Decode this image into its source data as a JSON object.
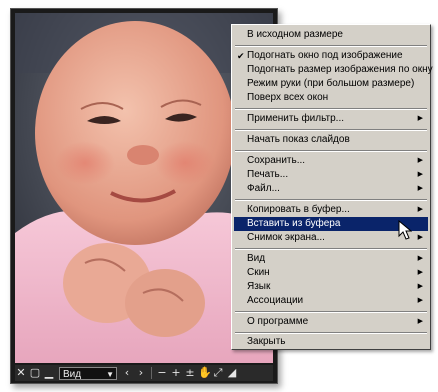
{
  "toolbar": {
    "close_icon": "close-icon",
    "restore_icon": "window-icon",
    "minimize_icon": "minimize-icon",
    "view_select_value": "Вид",
    "prev_icon": "chevron-left-icon",
    "next_icon": "chevron-right-icon",
    "zoom_out_icon": "minus-icon",
    "zoom_in_icon": "plus-icon",
    "fit_icon": "fit-icon",
    "hand_icon": "hand-icon",
    "fullscreen_icon": "fullscreen-icon",
    "resize_icon": "resize-grip-icon"
  },
  "menu": {
    "items": [
      {
        "label": "В исходном размере"
      },
      {
        "label": "Подогнать окно под изображение",
        "checked": true
      },
      {
        "label": "Подогнать размер изображения по окну"
      },
      {
        "label": "Режим руки (при большом размере)"
      },
      {
        "label": "Поверх всех окон"
      },
      {
        "label": "Применить фильтр...",
        "submenu": true
      },
      {
        "label": "Начать показ слайдов"
      },
      {
        "label": "Сохранить...",
        "submenu": true
      },
      {
        "label": "Печать...",
        "submenu": true
      },
      {
        "label": "Файл...",
        "submenu": true
      },
      {
        "label": "Копировать в буфер...",
        "submenu": true
      },
      {
        "label": "Вставить из буфера",
        "selected": true
      },
      {
        "label": "Снимок экрана...",
        "submenu": true
      },
      {
        "label": "Вид",
        "submenu": true
      },
      {
        "label": "Скин",
        "submenu": true
      },
      {
        "label": "Язык",
        "submenu": true
      },
      {
        "label": "Ассоциации",
        "submenu": true
      },
      {
        "label": "О программе",
        "submenu": true
      },
      {
        "label": "Закрыть"
      }
    ],
    "colors": {
      "background": "#d4d0c8",
      "selection": "#0a246a"
    }
  }
}
